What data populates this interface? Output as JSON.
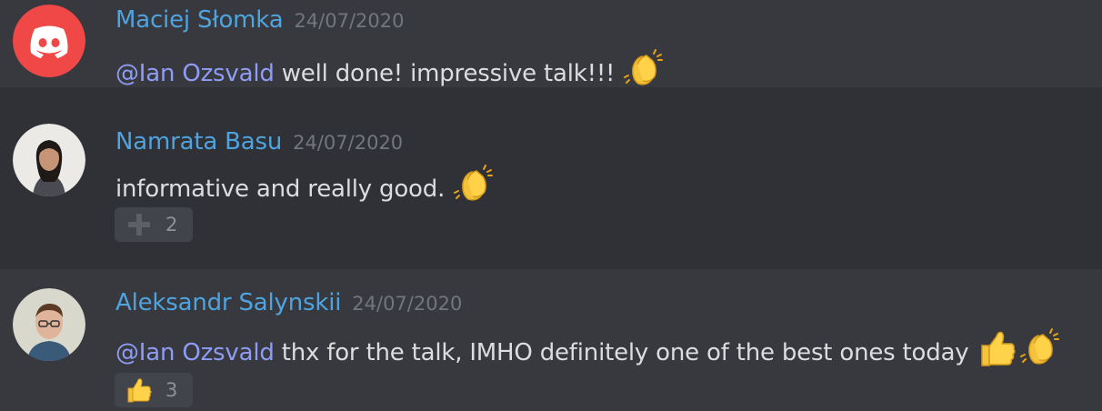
{
  "colors": {
    "background": "#36393f",
    "alt_background": "#2f3136",
    "username": "#4fa3df",
    "mention": "#8f9cf5",
    "timestamp": "#72767d",
    "text": "#dcddde",
    "reaction_bg": "#41444a"
  },
  "messages": [
    {
      "author": "Maciej Słomka",
      "timestamp": "24/07/2020",
      "avatar_icon": "discord-logo-icon",
      "mention": "@Ian Ozsvald",
      "text": " well done! impressive talk!!!",
      "emojis": [
        "clapping-hands-icon"
      ]
    },
    {
      "author": "Namrata Basu",
      "timestamp": "24/07/2020",
      "avatar_icon": "user-avatar-photo",
      "mention": "",
      "text": "informative and really good.",
      "emojis": [
        "clapping-hands-icon"
      ],
      "reaction": {
        "icon": "plus-icon",
        "count": "2"
      }
    },
    {
      "author": "Aleksandr Salynskii",
      "timestamp": "24/07/2020",
      "avatar_icon": "user-avatar-photo",
      "mention": "@Ian Ozsvald",
      "text": " thx for the talk, IMHO definitely one of the best ones today",
      "emojis": [
        "thumbs-up-icon",
        "clapping-hands-icon"
      ],
      "reaction": {
        "icon": "thumbs-up-icon",
        "count": "3"
      }
    }
  ]
}
